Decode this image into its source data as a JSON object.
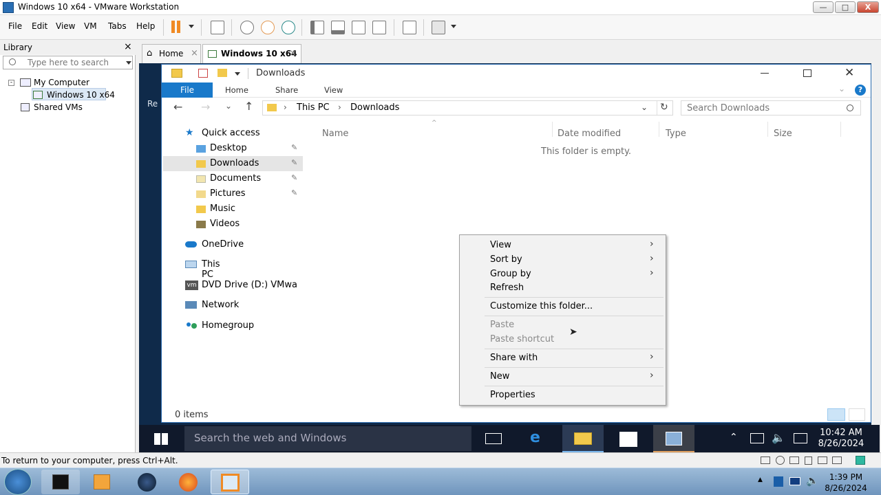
{
  "window": {
    "title": "Windows 10 x64 - VMware Workstation",
    "minimize": "—",
    "maximize": "□",
    "close": "X"
  },
  "menu": [
    "File",
    "Edit",
    "View",
    "VM",
    "Tabs",
    "Help"
  ],
  "library": {
    "title": "Library",
    "close": "×",
    "search_placeholder": "Type here to search",
    "tree": [
      "My Computer",
      "Windows 10 x64",
      "Shared VMs"
    ]
  },
  "tabs": [
    {
      "label": "Home",
      "close": "×"
    },
    {
      "label": "Windows 10 x64",
      "close": "×"
    }
  ],
  "explorer": {
    "title": "Downloads",
    "ribbon": {
      "file": "File",
      "home": "Home",
      "share": "Share",
      "view": "View"
    },
    "address": {
      "this_pc": "This PC",
      "downloads": "Downloads"
    },
    "search_placeholder": "Search Downloads",
    "nav": {
      "quick_access": "Quick access",
      "desktop": "Desktop",
      "downloads": "Downloads",
      "documents": "Documents",
      "pictures": "Pictures",
      "music": "Music",
      "videos": "Videos",
      "onedrive": "OneDrive",
      "this_pc": "This PC",
      "dvd": "DVD Drive (D:) VMwa",
      "network": "Network",
      "homegroup": "Homegroup"
    },
    "columns": {
      "name": "Name",
      "date": "Date modified",
      "type": "Type",
      "size": "Size"
    },
    "empty_message": "This folder is empty.",
    "status": "0 items",
    "behind_text": "Re"
  },
  "context_menu": {
    "view": "View",
    "sort_by": "Sort by",
    "group_by": "Group by",
    "refresh": "Refresh",
    "customize": "Customize this folder...",
    "paste": "Paste",
    "paste_shortcut": "Paste shortcut",
    "share_with": "Share with",
    "new": "New",
    "properties": "Properties"
  },
  "win10_taskbar": {
    "search_placeholder": "Search the web and Windows",
    "time": "10:42 AM",
    "date": "8/26/2024"
  },
  "vmware_status": "To return to your computer, press Ctrl+Alt.",
  "host_taskbar": {
    "time": "1:39 PM",
    "date": "8/26/2024"
  }
}
